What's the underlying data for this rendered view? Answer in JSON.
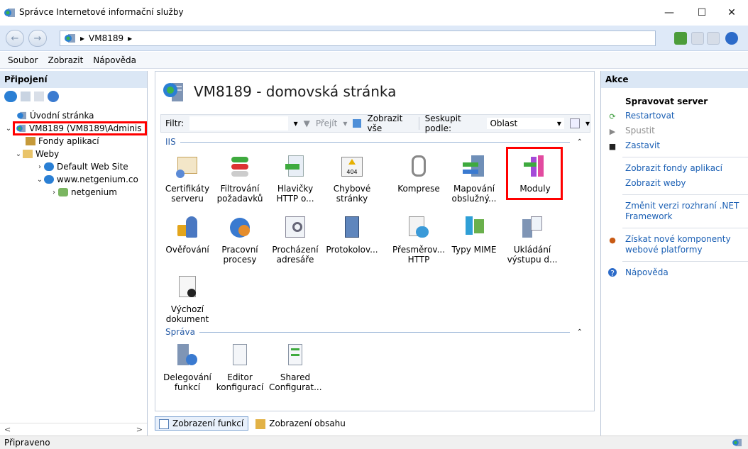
{
  "window": {
    "title": "Správce Internetové informační služby",
    "minimize": "—",
    "maximize": "☐",
    "close": "✕"
  },
  "address": {
    "back": "←",
    "forward": "→",
    "path_sep": "▸",
    "node": "VM8189"
  },
  "menu": {
    "items": [
      "Soubor",
      "Zobrazit",
      "Nápověda"
    ]
  },
  "left": {
    "header": "Připojení",
    "tree": {
      "home": "Úvodní stránka",
      "server": "VM8189 (VM8189\\Adminis",
      "app_pools": "Fondy aplikací",
      "sites": "Weby",
      "default_site": "Default Web Site",
      "site2": "www.netgenium.co",
      "app": "netgenium"
    },
    "scroll_left": "<",
    "scroll_right": ">"
  },
  "center": {
    "title": "VM8189 - domovská stránka",
    "filter_label": "Filtr:",
    "go_label": "Přejít",
    "show_all": "Zobrazit vše",
    "group_by_label": "Seskupit podle:",
    "group_by_value": "Oblast",
    "group_iis": "IIS",
    "group_manage": "Správa",
    "features_iis": [
      {
        "l1": "Certifikáty",
        "l2": "serveru"
      },
      {
        "l1": "Filtrování",
        "l2": "požadavků"
      },
      {
        "l1": "Hlavičky",
        "l2": "HTTP o..."
      },
      {
        "l1": "Chybové",
        "l2": "stránky"
      },
      {
        "l1": "Komprese",
        "l2": ""
      },
      {
        "l1": "Mapování",
        "l2": "obslužný..."
      },
      {
        "l1": "Moduly",
        "l2": ""
      },
      {
        "l1": "Ověřování",
        "l2": ""
      },
      {
        "l1": "Pracovní",
        "l2": "procesy"
      },
      {
        "l1": "Procházení",
        "l2": "adresáře"
      },
      {
        "l1": "Protokolov...",
        "l2": ""
      },
      {
        "l1": "Přesměrov...",
        "l2": "HTTP"
      },
      {
        "l1": "Typy MIME",
        "l2": ""
      },
      {
        "l1": "Ukládání",
        "l2": "výstupu d..."
      },
      {
        "l1": "Výchozí",
        "l2": "dokument"
      }
    ],
    "features_manage": [
      {
        "l1": "Delegování",
        "l2": "funkcí"
      },
      {
        "l1": "Editor",
        "l2": "konfigurací"
      },
      {
        "l1": "Shared",
        "l2": "Configurat..."
      }
    ],
    "tab_features": "Zobrazení funkcí",
    "tab_content": "Zobrazení obsahu",
    "icon_404": "404"
  },
  "right": {
    "header": "Akce",
    "title": "Spravovat server",
    "restart": "Restartovat",
    "start": "Spustit",
    "stop": "Zastavit",
    "view_pools": "Zobrazit fondy aplikací",
    "view_sites": "Zobrazit weby",
    "change_net": "Změnit verzi rozhraní .NET Framework",
    "get_components": "Získat nové komponenty webové platformy",
    "help": "Nápověda"
  },
  "status": {
    "text": "Připraveno"
  },
  "colors": {
    "accent": "#1a5fb4",
    "highlight": "#ff0000",
    "group": "#2b5fa8"
  }
}
